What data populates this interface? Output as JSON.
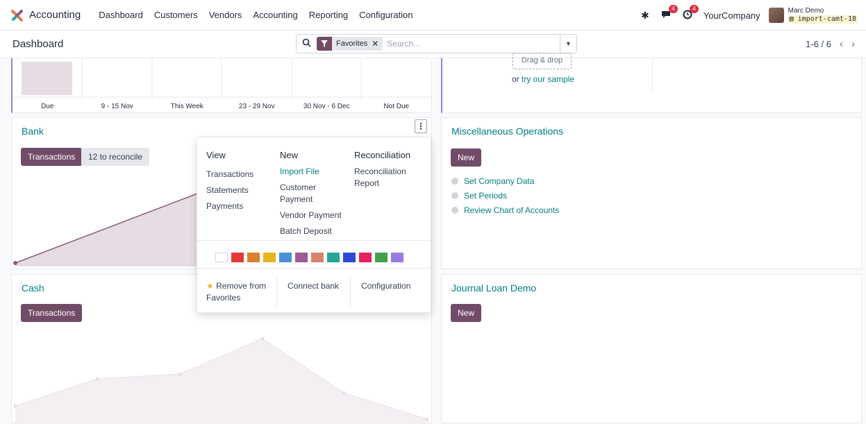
{
  "app": {
    "name": "Accounting"
  },
  "menu": [
    "Dashboard",
    "Customers",
    "Vendors",
    "Accounting",
    "Reporting",
    "Configuration"
  ],
  "systray": {
    "messages_count": "4",
    "activities_count": "4",
    "company": "YourCompany",
    "user": "Marc Demo",
    "database": "import-camt-18"
  },
  "control": {
    "breadcrumb": "Dashboard",
    "facet_label": "Favorites",
    "search_placeholder": "Search...",
    "pager": "1-6 / 6"
  },
  "top_left_card": {
    "xlabels": [
      "Due",
      "9 - 15 Nov",
      "This Week",
      "23 - 29 Nov",
      "30 Nov - 6 Dec",
      "Not Due"
    ]
  },
  "top_right_card": {
    "drag_text": "Drag & drop",
    "or_text": "or",
    "sample_link": "try our sample"
  },
  "bank": {
    "title": "Bank",
    "btn_transactions": "Transactions",
    "btn_reconcile": "12 to reconcile"
  },
  "misc": {
    "title": "Miscellaneous Operations",
    "btn_new": "New",
    "items": [
      "Set Company Data",
      "Set Periods",
      "Review Chart of Accounts"
    ]
  },
  "cash": {
    "title": "Cash",
    "btn_transactions": "Transactions"
  },
  "loan": {
    "title": "Journal Loan Demo",
    "btn_new": "New"
  },
  "dropdown": {
    "view": {
      "header": "View",
      "items": [
        "Transactions",
        "Statements",
        "Payments"
      ]
    },
    "new": {
      "header": "New",
      "items": [
        "Import File",
        "Customer Payment",
        "Vendor Payment",
        "Batch Deposit"
      ]
    },
    "reconciliation": {
      "header": "Reconciliation",
      "items": [
        "Reconciliation Report"
      ]
    },
    "colors": [
      "#ffffff",
      "#e53935",
      "#d97f2e",
      "#e8b51f",
      "#4a90d9",
      "#9c5b94",
      "#d9846a",
      "#26a69a",
      "#2e48d6",
      "#e91e63",
      "#43a047",
      "#9b7be0"
    ],
    "footer": {
      "remove": "Remove from Favorites",
      "connect": "Connect bank",
      "config": "Configuration"
    }
  },
  "colors": {
    "primary": "#714b67",
    "link": "#017e84",
    "chart_fill": "#e6dce3",
    "chart_line": "#8a5d7d"
  }
}
